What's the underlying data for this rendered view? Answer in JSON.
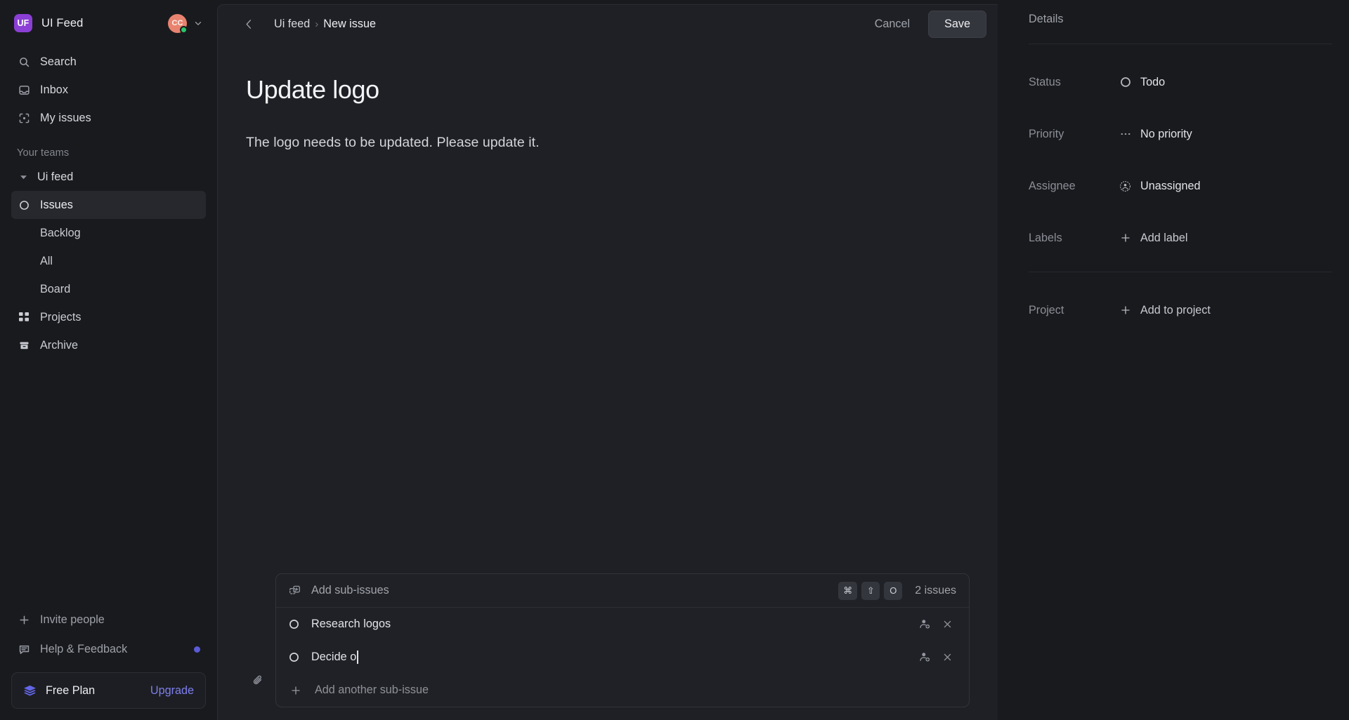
{
  "sidebar": {
    "workspace": {
      "logo_text": "UF",
      "name": "UI Feed",
      "logo_color": "#8b3fd4",
      "avatar_initials": "CC",
      "avatar_color": "#e8836f",
      "presence_color": "#2bc46a"
    },
    "nav": [
      {
        "label": "Search",
        "icon": "search-icon"
      },
      {
        "label": "Inbox",
        "icon": "inbox-icon"
      },
      {
        "label": "My issues",
        "icon": "my-issues-icon"
      }
    ],
    "section_label": "Your teams",
    "team": {
      "label": "Ui feed"
    },
    "team_items": [
      {
        "label": "Issues",
        "icon": "circle-icon",
        "active": true
      },
      {
        "label": "Backlog",
        "icon": "",
        "active": false
      },
      {
        "label": "All",
        "icon": "",
        "active": false
      },
      {
        "label": "Board",
        "icon": "",
        "active": false
      },
      {
        "label": "Projects",
        "icon": "grid-icon",
        "active": false
      },
      {
        "label": "Archive",
        "icon": "archive-icon",
        "active": false
      }
    ],
    "bottom": [
      {
        "label": "Invite people",
        "icon": "plus-icon"
      },
      {
        "label": "Help & Feedback",
        "icon": "chat-icon",
        "badge": true
      }
    ],
    "plan": {
      "name": "Free Plan",
      "action": "Upgrade",
      "accent": "#7e7fec"
    }
  },
  "topbar": {
    "breadcrumb_team": "Ui feed",
    "breadcrumb_sep": "›",
    "breadcrumb_page": "New issue",
    "cancel_label": "Cancel",
    "save_label": "Save"
  },
  "issue": {
    "title": "Update logo",
    "description": "The logo needs to be updated. Please update it."
  },
  "subissues": {
    "header_label": "Add sub-issues",
    "shortcut_keys": [
      "⌘",
      "⇧",
      "O"
    ],
    "count_label": "2 issues",
    "rows": [
      {
        "title": "Research logos",
        "editing": false
      },
      {
        "title": "Decide o",
        "editing": true
      }
    ],
    "add_label": "Add another sub-issue"
  },
  "details": {
    "heading": "Details",
    "fields": [
      {
        "label": "Status",
        "value": "Todo",
        "icon": "status-todo-icon"
      },
      {
        "label": "Priority",
        "value": "No priority",
        "icon": "priority-none-icon"
      },
      {
        "label": "Assignee",
        "value": "Unassigned",
        "icon": "user-circle-icon"
      },
      {
        "label": "Labels",
        "value": "Add label",
        "icon": "plus-icon"
      },
      {
        "label": "Project",
        "value": "Add to project",
        "icon": "plus-icon"
      }
    ]
  }
}
